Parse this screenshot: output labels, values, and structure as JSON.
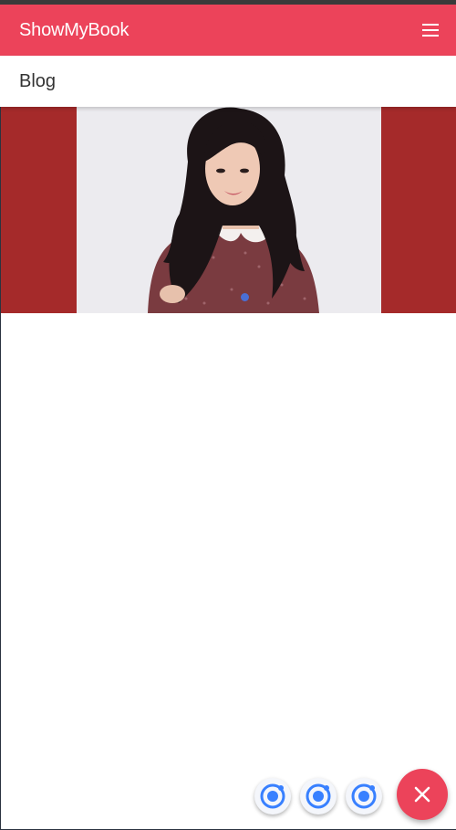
{
  "app": {
    "title": "ShowMyBook",
    "menu_icon": "menu-icon"
  },
  "header": {
    "title": "Blog"
  },
  "slider": {
    "image": "woman-portrait-photo",
    "active_slide": 1,
    "slide_count": 1
  },
  "fab": {
    "mini_buttons": [
      "ionic-logo-icon",
      "ionic-logo-icon",
      "ionic-logo-icon"
    ],
    "main_icon": "close-icon"
  },
  "colors": {
    "accent": "#ec435a",
    "slider_bg": "#a52a2a",
    "dot": "#4a6fd6",
    "ionic_blue": "#3880ff"
  }
}
